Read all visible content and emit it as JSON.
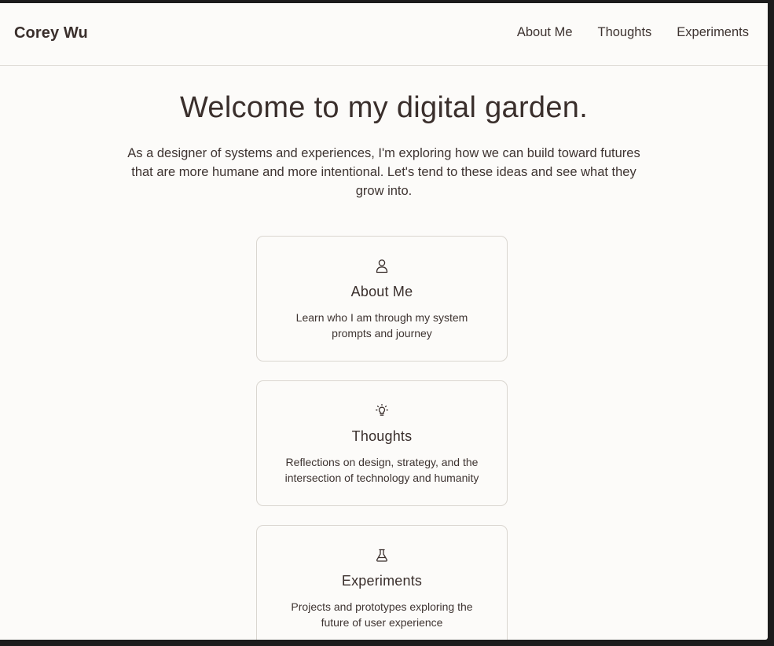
{
  "header": {
    "brand": "Corey Wu",
    "nav": [
      {
        "label": "About Me"
      },
      {
        "label": "Thoughts"
      },
      {
        "label": "Experiments"
      }
    ]
  },
  "hero": {
    "title": "Welcome to my digital garden.",
    "intro": "As a designer of systems and experiences, I'm exploring how we can build toward futures that are more humane and more intentional. Let's tend to these ideas and see what they grow into."
  },
  "cards": [
    {
      "icon": "user-icon",
      "title": "About Me",
      "description": "Learn who I am through my system prompts and journey"
    },
    {
      "icon": "lightbulb-icon",
      "title": "Thoughts",
      "description": "Reflections on design, strategy, and the intersection of technology and humanity"
    },
    {
      "icon": "flask-icon",
      "title": "Experiments",
      "description": "Projects and prototypes exploring the future of user experience"
    }
  ],
  "colors": {
    "text": "#3a2f2c",
    "background": "#fcfbf9",
    "border": "#dad6d0"
  }
}
